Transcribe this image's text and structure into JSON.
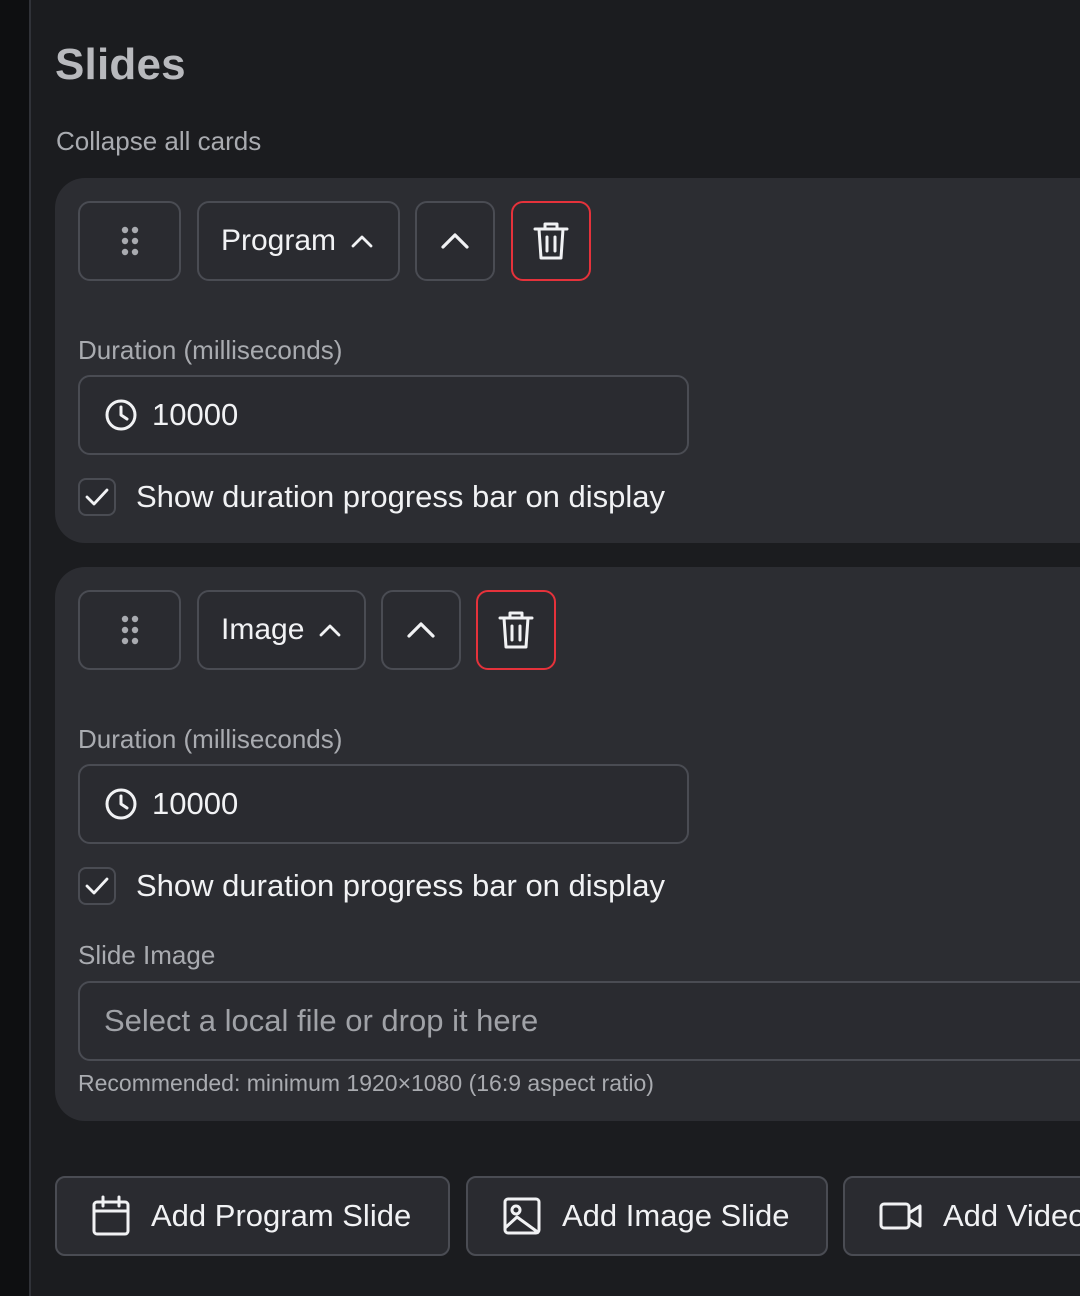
{
  "page": {
    "title": "Slides",
    "collapse_all": "Collapse all cards"
  },
  "cards": [
    {
      "type_label": "Program",
      "duration_label": "Duration (milliseconds)",
      "duration_value": "10000",
      "progress_checkbox_label": "Show duration progress bar on display",
      "progress_checked": true
    },
    {
      "type_label": "Image",
      "duration_label": "Duration (milliseconds)",
      "duration_value": "10000",
      "progress_checkbox_label": "Show duration progress bar on display",
      "progress_checked": true,
      "image_label": "Slide Image",
      "image_placeholder": "Select a local file or drop it here",
      "image_help": "Recommended: minimum 1920×1080 (16:9 aspect ratio)"
    }
  ],
  "actions": {
    "add_program": "Add Program Slide",
    "add_image": "Add Image Slide",
    "add_video": "Add Video Slide"
  },
  "colors": {
    "background": "#1b1c1f",
    "card": "#2c2d32",
    "border": "#4a4c53",
    "danger": "#e5323b",
    "text": "#f1f2f4",
    "muted_text": "#a9abb0"
  }
}
